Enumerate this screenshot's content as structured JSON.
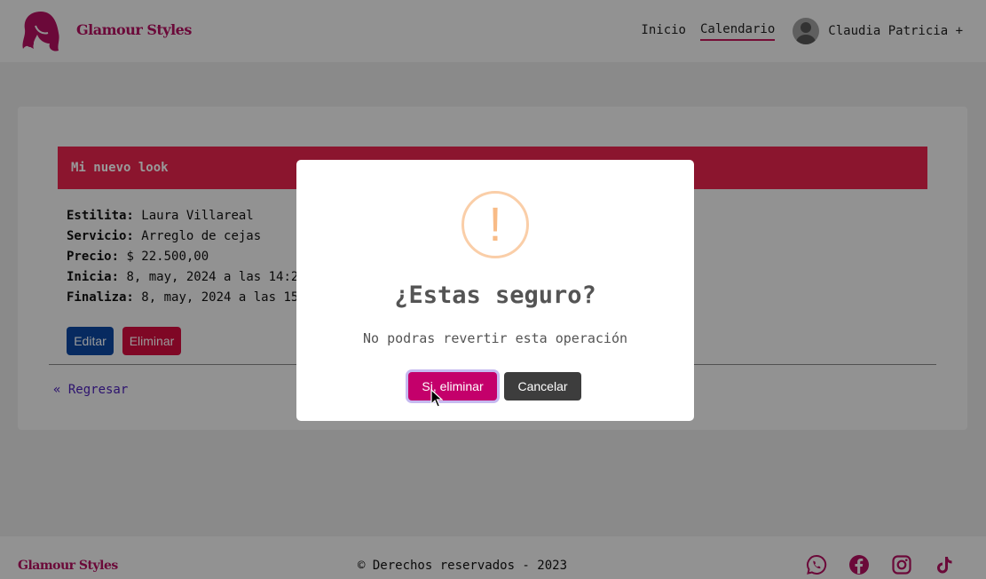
{
  "header": {
    "brand": "Glamour Styles",
    "nav": {
      "home": "Inicio",
      "calendar": "Calendario"
    },
    "user": "Claudia Patricia +"
  },
  "appointment": {
    "title": "Mi nuevo look",
    "details": [
      {
        "label": "Estilita:",
        "value": "Laura Villareal"
      },
      {
        "label": "Servicio:",
        "value": "Arreglo de cejas"
      },
      {
        "label": "Precio:",
        "value": "$ 22.500,00"
      },
      {
        "label": "Inicia:",
        "value": "8, may, 2024 a las 14:2"
      },
      {
        "label": "Finaliza:",
        "value": "8, may, 2024 a las 15"
      }
    ],
    "edit_label": "Editar",
    "delete_label": "Eliminar",
    "back_label": "« Regresar"
  },
  "footer": {
    "brand": "Glamour Styles",
    "copyright": "© Derechos reservados - 2023",
    "social_icons": [
      "whatsapp-icon",
      "facebook-icon",
      "instagram-icon",
      "tiktok-icon"
    ]
  },
  "modal": {
    "icon": "!",
    "title": "¿Estas seguro?",
    "text": "No podras revertir esta operación",
    "confirm_label": "Si, eliminar",
    "cancel_label": "Cancelar"
  },
  "colors": {
    "brand": "#b3105f",
    "card_header": "#e8244e",
    "confirm": "#c4006b",
    "cancel": "#3d3d3d",
    "edit": "#0d47a1",
    "delete": "#d40c3f"
  }
}
